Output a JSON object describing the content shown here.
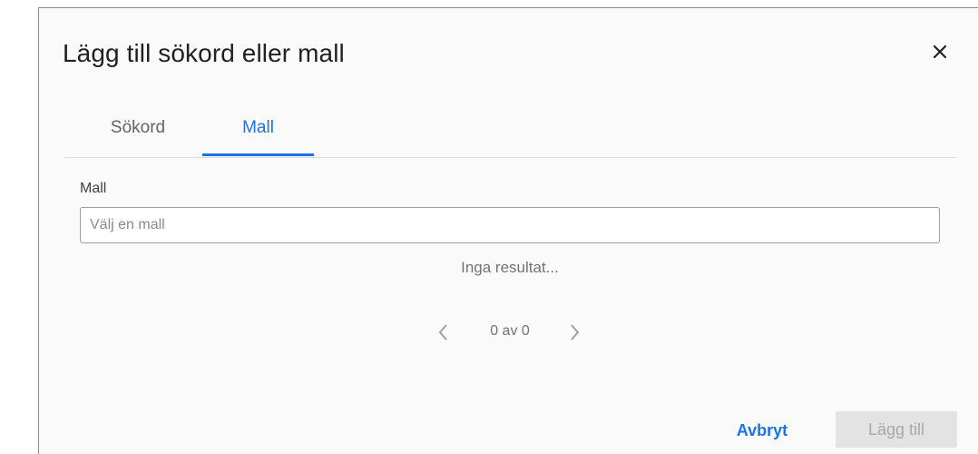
{
  "dialog": {
    "title": "Lägg till sökord eller mall"
  },
  "tabs": [
    {
      "label": "Sökord",
      "active": false
    },
    {
      "label": "Mall",
      "active": true
    }
  ],
  "template_field": {
    "label": "Mall",
    "value": "",
    "placeholder": "Välj en mall"
  },
  "results": {
    "empty_text": "Inga resultat..."
  },
  "pager": {
    "count_text": "0 av 0"
  },
  "actions": {
    "cancel_label": "Avbryt",
    "add_label": "Lägg till"
  },
  "icons": {
    "close": "close-icon",
    "prev": "chevron-left-icon",
    "next": "chevron-right-icon"
  },
  "colors": {
    "accent": "#1a73e8",
    "disabled_bg": "#e3e3e3",
    "disabled_text": "#a8a8a8"
  }
}
